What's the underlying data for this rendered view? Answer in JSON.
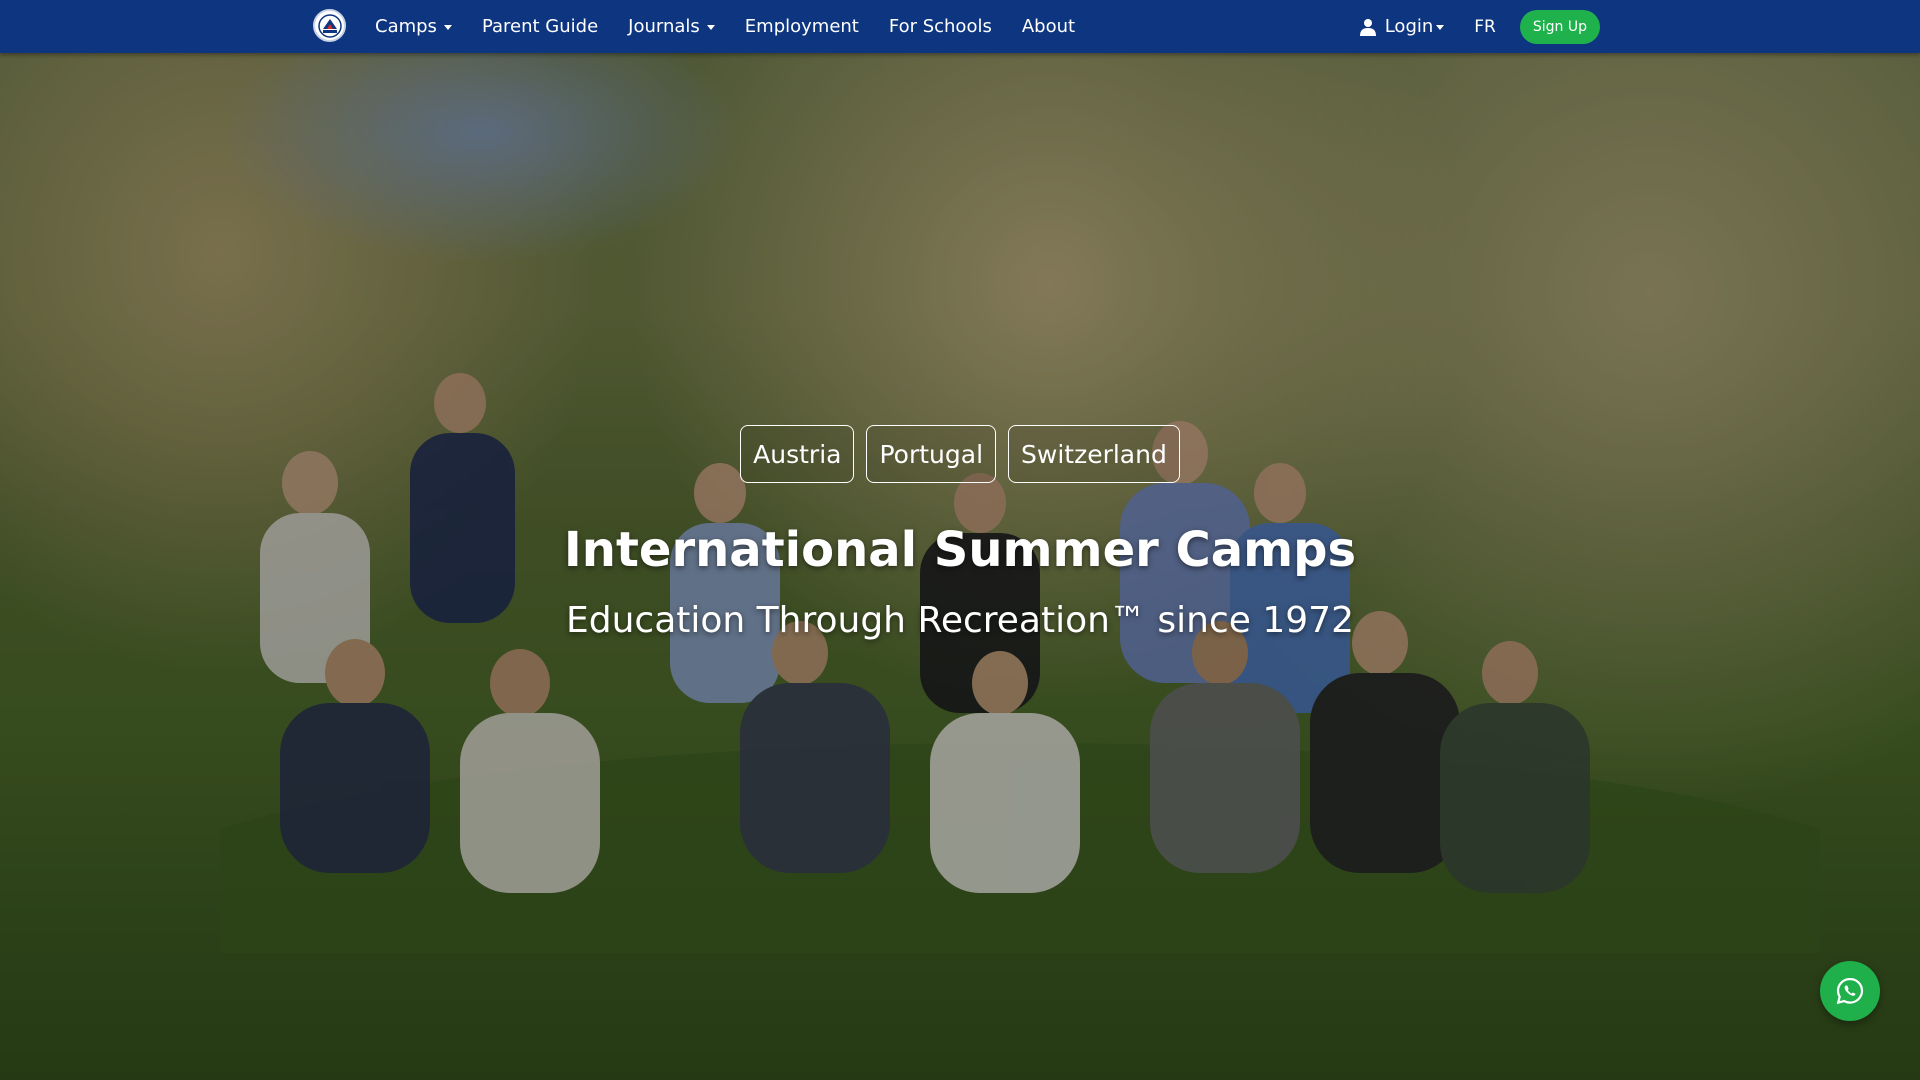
{
  "brand": {
    "logo_icon": "camp-logo-icon"
  },
  "nav": {
    "items": [
      {
        "label": "Camps",
        "has_dropdown": true
      },
      {
        "label": "Parent Guide",
        "has_dropdown": false
      },
      {
        "label": "Journals",
        "has_dropdown": true
      },
      {
        "label": "Employment",
        "has_dropdown": false
      },
      {
        "label": "For Schools",
        "has_dropdown": false
      },
      {
        "label": "About",
        "has_dropdown": false
      }
    ],
    "login_label": "Login",
    "login_icon": "user-icon",
    "language_label": "FR",
    "signup_label": "Sign Up"
  },
  "hero": {
    "countries": [
      "Austria",
      "Portugal",
      "Switzerland"
    ],
    "title": "International Summer Camps",
    "subtitle": "Education Through Recreation™ since 1972"
  },
  "floating": {
    "whatsapp_icon": "whatsapp-icon"
  },
  "colors": {
    "navbar": "#0e3680",
    "signup": "#1fb14c",
    "whatsapp": "#1faf4b"
  }
}
